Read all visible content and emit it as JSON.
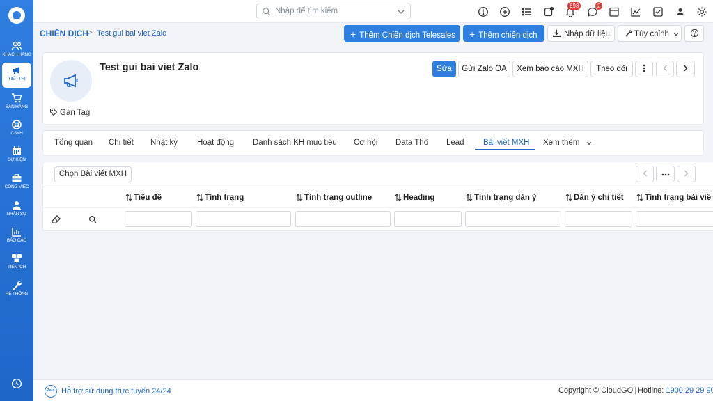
{
  "sidebar": {
    "items": [
      {
        "label": "KHÁCH HÀNG",
        "icon": "users-icon"
      },
      {
        "label": "TIẾP THỊ",
        "icon": "megaphone-icon",
        "active": true
      },
      {
        "label": "BÁN HÀNG",
        "icon": "cart-icon"
      },
      {
        "label": "CSKH",
        "icon": "lifebuoy-icon"
      },
      {
        "label": "SỰ KIỆN",
        "icon": "calendar-icon"
      },
      {
        "label": "CÔNG VIỆC",
        "icon": "briefcase-icon"
      },
      {
        "label": "NHÂN SỰ",
        "icon": "person-icon"
      },
      {
        "label": "BÁO CÁO",
        "icon": "report-icon"
      },
      {
        "label": "TIỆN ÍCH",
        "icon": "boxes-icon"
      },
      {
        "label": "HỆ THỐNG",
        "icon": "wrench-icon"
      }
    ]
  },
  "topbar": {
    "search_placeholder": "Nhập để tìm kiếm",
    "notifications_count": "693",
    "messages_count": "2"
  },
  "breadcrumb": {
    "module": "CHIẾN DỊCH",
    "separator": ">",
    "record": "Test gui bai viet Zalo"
  },
  "actions": {
    "add_telesales": "Thêm Chiến dịch Telesales",
    "add_campaign": "Thêm chiến dịch",
    "import": "Nhập dữ liệu",
    "customize": "Tùy chỉnh"
  },
  "record": {
    "title": "Test gui bai viet Zalo",
    "tag_label": "Gán Tag",
    "buttons": {
      "edit": "Sửa",
      "send_zalo": "Gửi Zalo OA",
      "view_report": "Xem báo cáo MXH",
      "follow": "Theo dõi"
    }
  },
  "tabs": [
    {
      "label": "Tổng quan"
    },
    {
      "label": "Chi tiết"
    },
    {
      "label": "Nhật ký"
    },
    {
      "label": "Hoạt động"
    },
    {
      "label": "Danh sách KH mục tiêu"
    },
    {
      "label": "Cơ hội"
    },
    {
      "label": "Data Thô"
    },
    {
      "label": "Lead"
    },
    {
      "label": "Bài viết MXH",
      "active": true
    },
    {
      "label": "Xem thêm"
    }
  ],
  "related": {
    "select_button": "Chọn Bài viết MXH",
    "columns": [
      "Tiêu đề",
      "Tình trạng",
      "Tình trạng outline",
      "Heading",
      "Tình trạng dàn ý",
      "Dàn ý chi tiết",
      "Tình trạng bài viế"
    ]
  },
  "footer": {
    "support": "Hỗ trợ sử dụng trực tuyến 24/24",
    "copyright": "Copyright © CloudGO",
    "hotline_label": "Hotline:",
    "hotline_number": "1900 29 29 90",
    "zalo_text": "Zalo"
  },
  "colors": {
    "accent": "#2f7fe0",
    "badge": "#e53935"
  }
}
